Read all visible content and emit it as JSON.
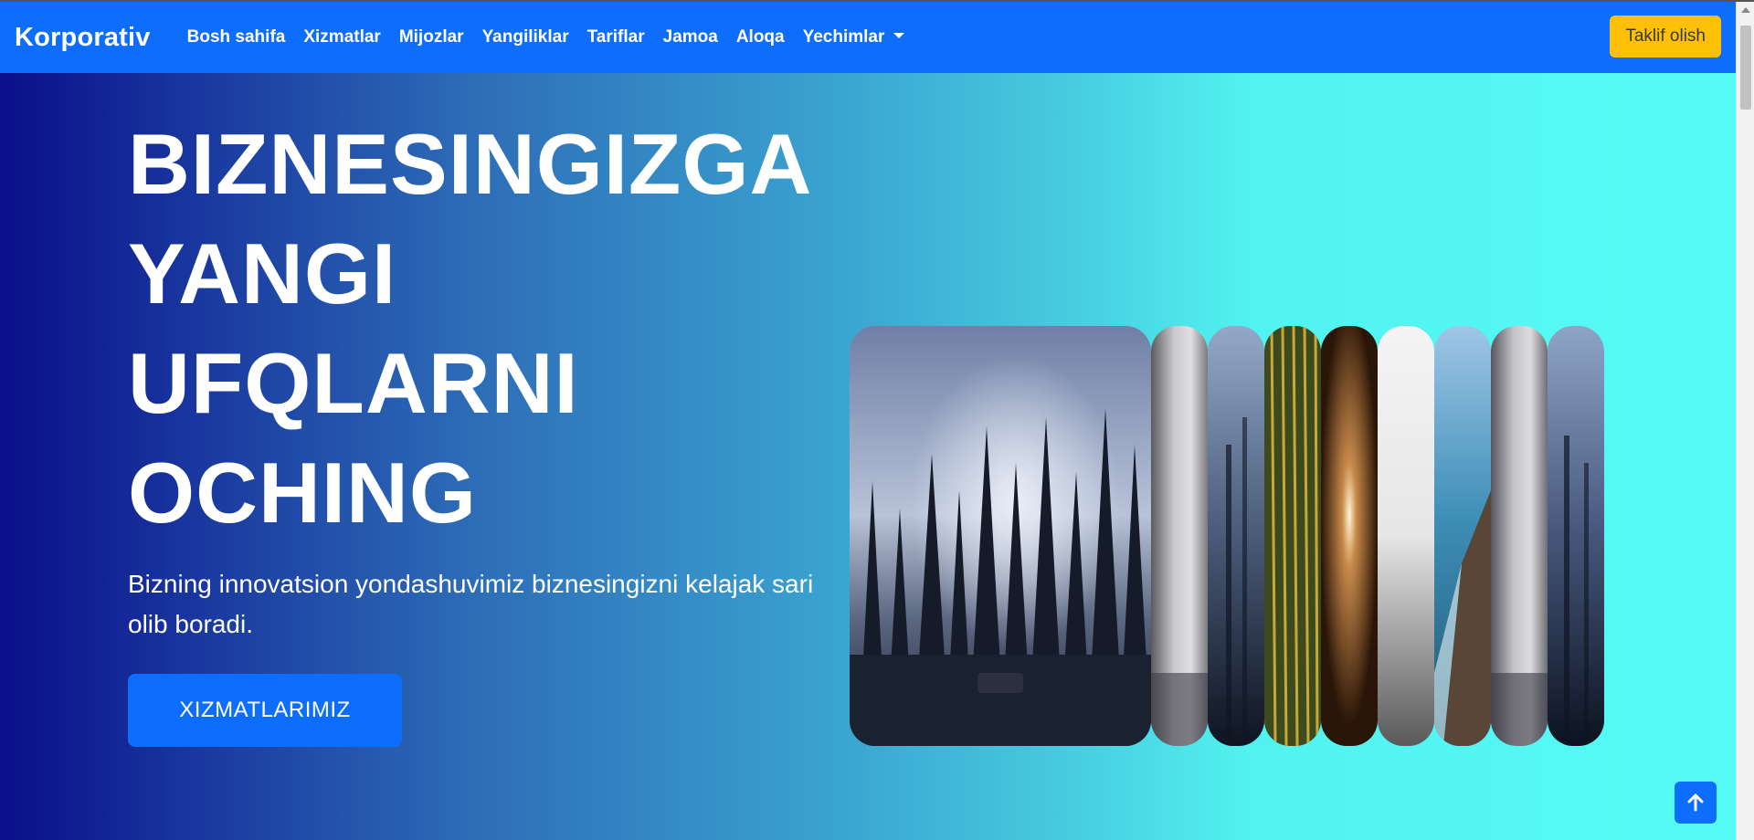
{
  "brand": "Korporativ",
  "nav": {
    "items": [
      {
        "label": "Bosh sahifa"
      },
      {
        "label": "Xizmatlar"
      },
      {
        "label": "Mijozlar"
      },
      {
        "label": "Yangiliklar"
      },
      {
        "label": "Tariflar"
      },
      {
        "label": "Jamoa"
      },
      {
        "label": "Aloqa"
      },
      {
        "label": "Yechimlar"
      }
    ],
    "cta_label": "Taklif olish"
  },
  "hero": {
    "title_lines": [
      "BIZNESINGIZGA",
      "YANGI",
      "UFQLARNI",
      "OCHING"
    ],
    "subtitle": "Bizning innovatsion yondashuvimiz biznesingizni kelajak sari olib boradi.",
    "button_label": "XIZMATLARIMIZ"
  },
  "gallery": {
    "panels": [
      "forest-image",
      "birch-bark-image",
      "blurred-forest-image",
      "green-stripes-image",
      "wood-glow-image",
      "white-fog-image",
      "coast-cliff-image",
      "birch-bark-image",
      "blurred-forest-image"
    ]
  },
  "colors": {
    "primary": "#0d6efd",
    "warning": "#ffc107",
    "gradient_start": "#0a0f8a",
    "gradient_end": "#55fbf6"
  }
}
